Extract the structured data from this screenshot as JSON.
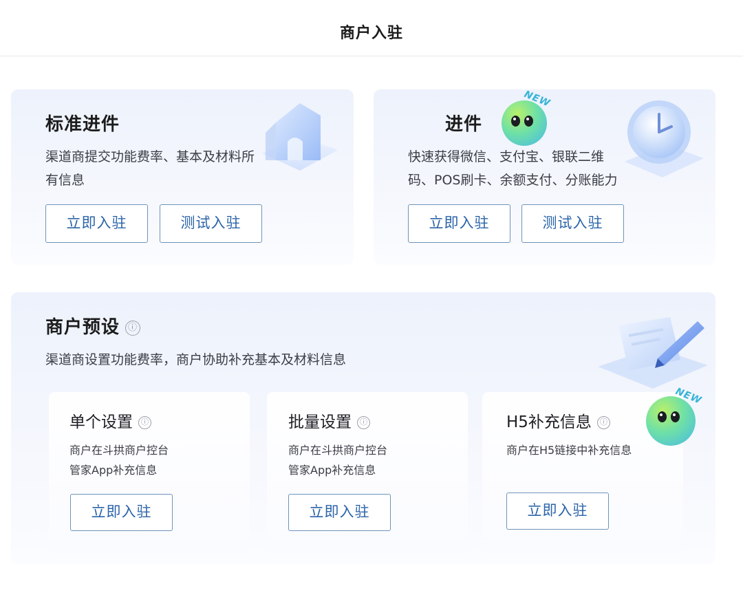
{
  "header": {
    "title": "商户入驻"
  },
  "standard_card": {
    "title": "标准进件",
    "desc_line1": "渠道商提交功能费率、基本及材料所",
    "desc_line2": "有信息",
    "primary_button": "立即入驻",
    "test_button": "测试入驻",
    "illustration_icon": "house-icon"
  },
  "express_card": {
    "title": "进件",
    "badge": "NEW",
    "desc_line1": "快速获得微信、支付宝、银联二维",
    "desc_line2": "码、POS刷卡、余额支付、分账能力",
    "primary_button": "立即入驻",
    "test_button": "测试入驻",
    "illustration_icon": "clock-icon"
  },
  "preset_card": {
    "title": "商户预设",
    "info_icon": "ⓘ",
    "desc": "渠道商设置功能费率，商户协助补充基本及材料信息",
    "illustration_icon": "document-pen-icon",
    "options": [
      {
        "title": "单个设置",
        "desc_line1": "商户在斗拱商户控台",
        "desc_line2": "管家App补充信息",
        "button": "立即入驻"
      },
      {
        "title": "批量设置",
        "desc_line1": "商户在斗拱商户控台",
        "desc_line2": "管家App补充信息",
        "button": "立即入驻"
      },
      {
        "title": "H5补充信息",
        "desc_line1": "商户在H5链接中补充信息",
        "desc_line2": "",
        "button": "立即入驻",
        "badge": "NEW"
      }
    ]
  },
  "colors": {
    "button_border": "#6e93b8",
    "button_text": "#2a63a8",
    "card_bg": "#edf2fc"
  }
}
